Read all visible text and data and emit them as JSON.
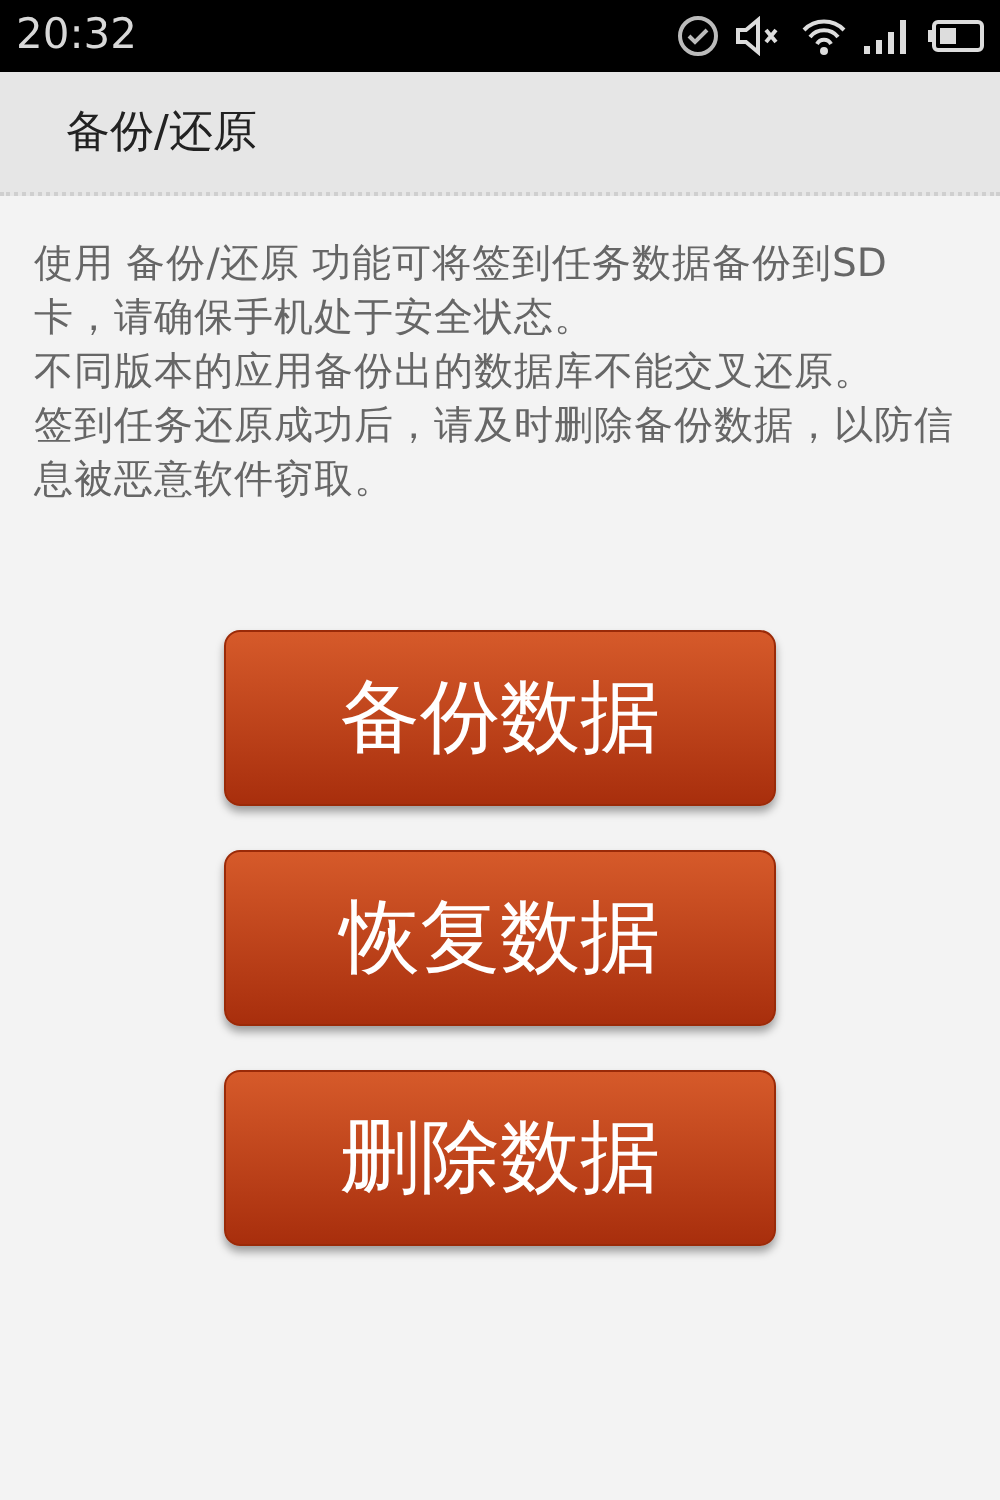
{
  "status_bar": {
    "time": "20:32"
  },
  "title_bar": {
    "title": "备份/还原"
  },
  "notice": [
    "使用 备份/还原 功能可将签到任务数据备份到SD卡，请确保手机处于安全状态。",
    "不同版本的应用备份出的数据库不能交叉还原。",
    "签到任务还原成功后，请及时删除备份数据，以防信息被恶意软件窃取。"
  ],
  "buttons": [
    {
      "label": "备份数据"
    },
    {
      "label": "恢复数据"
    },
    {
      "label": "删除数据"
    }
  ]
}
